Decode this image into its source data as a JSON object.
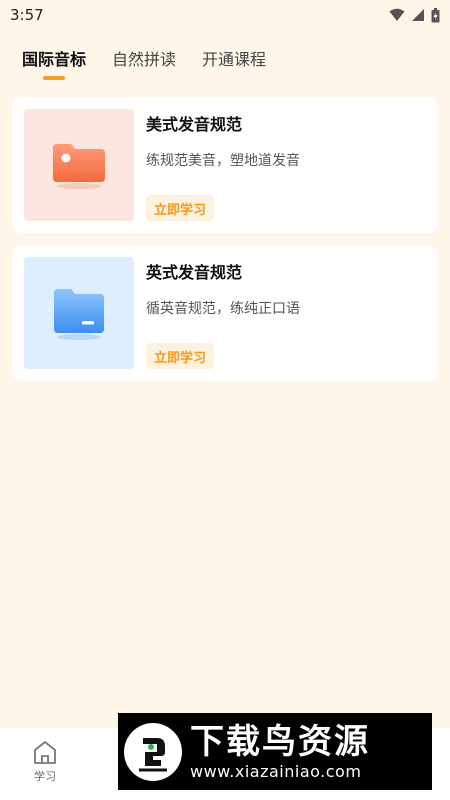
{
  "status_bar": {
    "time": "3:57"
  },
  "tabs": [
    {
      "label": "国际音标",
      "active": true
    },
    {
      "label": "自然拼读",
      "active": false
    },
    {
      "label": "开通课程",
      "active": false
    }
  ],
  "cards": [
    {
      "title": "美式发音规范",
      "desc": "练规范美音，塑地道发音",
      "button": "立即学习",
      "thumb_color": "#fde6df",
      "icon": "orange-folder-icon"
    },
    {
      "title": "英式发音规范",
      "desc": "循英音规范，练纯正口语",
      "button": "立即学习",
      "thumb_color": "#dceeff",
      "icon": "blue-folder-icon"
    }
  ],
  "bottom_nav": [
    {
      "label": "学习",
      "icon": "home-icon"
    }
  ],
  "watermark": {
    "title": "下载鸟资源",
    "url": "www.xiazainiao.com"
  },
  "colors": {
    "accent": "#f6a021",
    "background": "#fdf6e9",
    "button_text": "#f49a17"
  }
}
